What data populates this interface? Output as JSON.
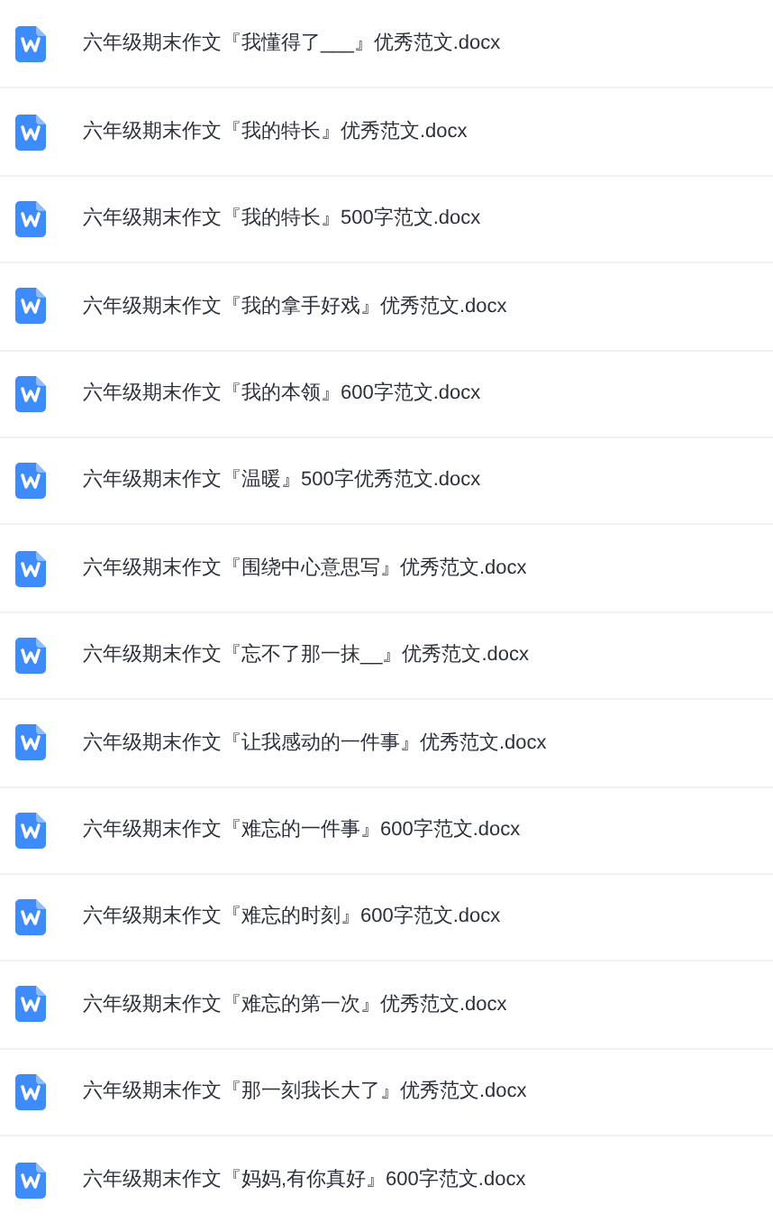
{
  "files": [
    {
      "name": "六年级期末作文『我懂得了___』优秀范文.docx"
    },
    {
      "name": "六年级期末作文『我的特长』优秀范文.docx"
    },
    {
      "name": "六年级期末作文『我的特长』500字范文.docx"
    },
    {
      "name": "六年级期末作文『我的拿手好戏』优秀范文.docx"
    },
    {
      "name": "六年级期末作文『我的本领』600字范文.docx"
    },
    {
      "name": "六年级期末作文『温暖』500字优秀范文.docx"
    },
    {
      "name": "六年级期末作文『围绕中心意思写』优秀范文.docx"
    },
    {
      "name": "六年级期末作文『忘不了那一抹__』优秀范文.docx"
    },
    {
      "name": "六年级期末作文『让我感动的一件事』优秀范文.docx"
    },
    {
      "name": "六年级期末作文『难忘的一件事』600字范文.docx"
    },
    {
      "name": "六年级期末作文『难忘的时刻』600字范文.docx"
    },
    {
      "name": "六年级期末作文『难忘的第一次』优秀范文.docx"
    },
    {
      "name": "六年级期末作文『那一刻我长大了』优秀范文.docx"
    },
    {
      "name": "六年级期末作文『妈妈,有你真好』600字范文.docx"
    }
  ]
}
